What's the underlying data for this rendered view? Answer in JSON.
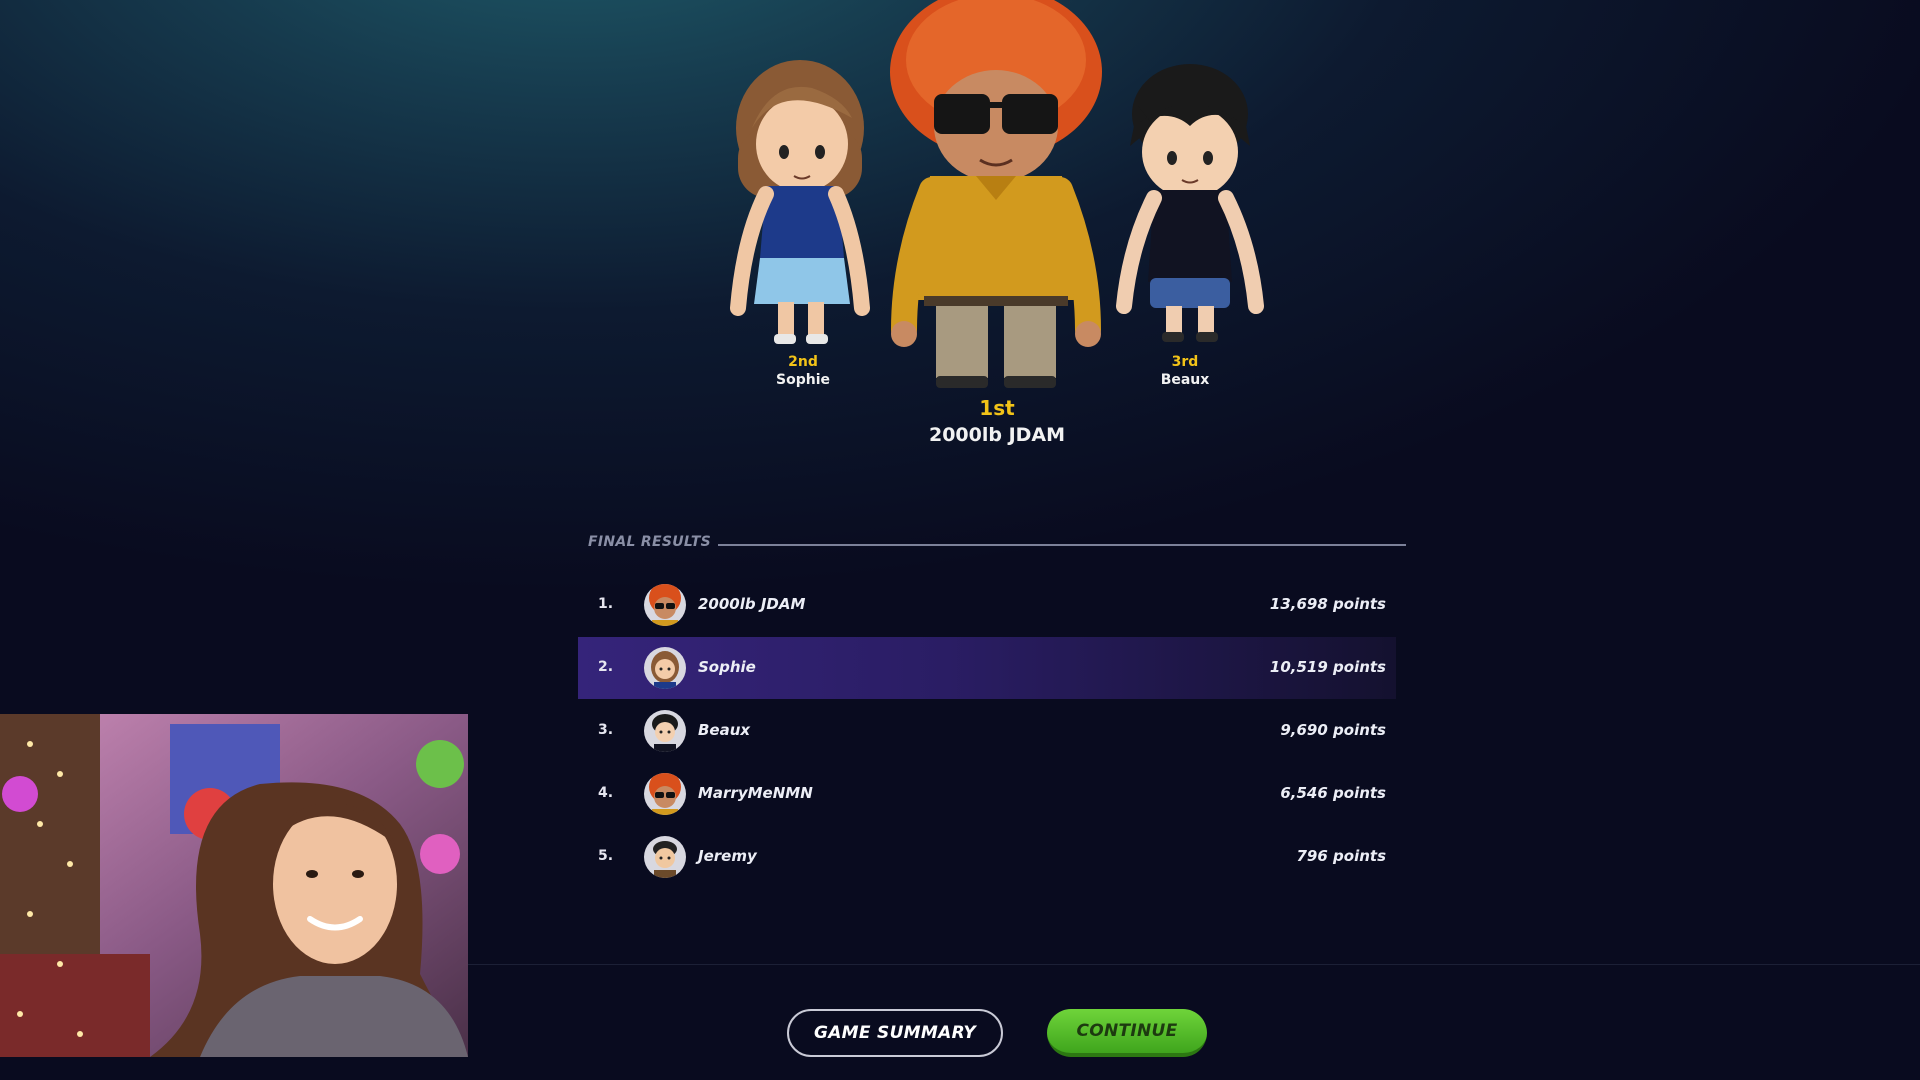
{
  "podium": {
    "first": {
      "rank": "1st",
      "name": "2000lb JDAM"
    },
    "second": {
      "rank": "2nd",
      "name": "Sophie"
    },
    "third": {
      "rank": "3rd",
      "name": "Beaux"
    }
  },
  "results": {
    "title": "FINAL RESULTS",
    "rows": [
      {
        "num": "1.",
        "name": "2000lb JDAM",
        "points": "13,698 points",
        "avatar": "afro-sunglasses-avatar"
      },
      {
        "num": "2.",
        "name": "Sophie",
        "points": "10,519 points",
        "avatar": "brown-hair-avatar"
      },
      {
        "num": "3.",
        "name": "Beaux",
        "points": "9,690 points",
        "avatar": "black-hair-avatar"
      },
      {
        "num": "4.",
        "name": "MarryMeNMN",
        "points": "6,546 points",
        "avatar": "afro-sunglasses-avatar"
      },
      {
        "num": "5.",
        "name": "Jeremy",
        "points": "796 points",
        "avatar": "dark-hair-avatar"
      }
    ],
    "highlighted_row": 2
  },
  "buttons": {
    "summary": "GAME SUMMARY",
    "continue": "CONTINUE"
  },
  "colors": {
    "rank_gold": "#f2c318",
    "highlight_row": "#35247a",
    "continue_green": "#4fbf24"
  }
}
